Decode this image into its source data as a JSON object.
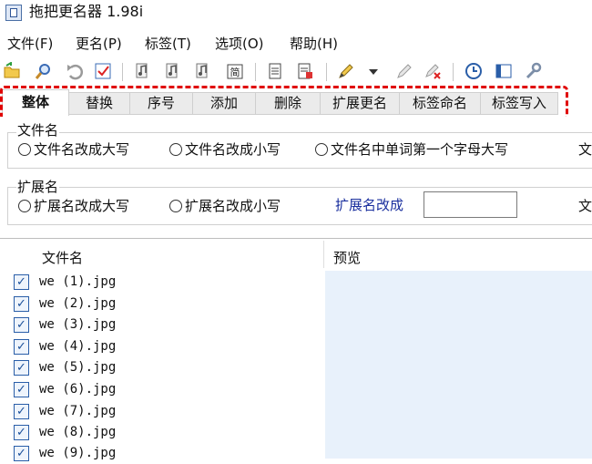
{
  "window": {
    "title": "拖把更名器 1.98i"
  },
  "menu": [
    "文件(F)",
    "更名(P)",
    "标签(T)",
    "选项(O)",
    "帮助(H)"
  ],
  "toolbar": {
    "icons": [
      "open-folder-icon",
      "search-icon",
      "undo-icon",
      "check-icon",
      "music-tag-icon",
      "music-tag-icon",
      "music-tag-icon",
      "simplified-chinese-icon",
      "document-icon",
      "document-edit-icon",
      "pencil-icon",
      "dropdown-arrow-icon",
      "pencil-icon",
      "pencil-delete-icon",
      "clock-icon",
      "window-icon",
      "wrench-icon"
    ]
  },
  "tabs": [
    "整体",
    "替换",
    "序号",
    "添加",
    "删除",
    "扩展更名",
    "标签命名",
    "标签写入"
  ],
  "active_tab": "整体",
  "filename_group": {
    "title": "文件名",
    "options": [
      "文件名改成大写",
      "文件名改成小写",
      "文件名中单词第一个字母大写"
    ],
    "overflow_text": "文"
  },
  "extension_group": {
    "title": "扩展名",
    "options": [
      "扩展名改成大写",
      "扩展名改成小写"
    ],
    "rename_label": "扩展名改成",
    "rename_value": "",
    "overflow_text": "文"
  },
  "file_list": {
    "columns": [
      "文件名",
      "预览"
    ],
    "rows": [
      {
        "name": "we (1).jpg",
        "checked": true
      },
      {
        "name": "we (2).jpg",
        "checked": true
      },
      {
        "name": "we (3).jpg",
        "checked": true
      },
      {
        "name": "we (4).jpg",
        "checked": true
      },
      {
        "name": "we (5).jpg",
        "checked": true
      },
      {
        "name": "we (6).jpg",
        "checked": true
      },
      {
        "name": "we (7).jpg",
        "checked": true
      },
      {
        "name": "we (8).jpg",
        "checked": true
      },
      {
        "name": "we (9).jpg",
        "checked": true
      }
    ]
  },
  "colors": {
    "highlight": "#e00000",
    "preview_bg": "#e8f1fb",
    "checkbox": "#2a5ea8",
    "link_label": "#1a2f9e"
  }
}
